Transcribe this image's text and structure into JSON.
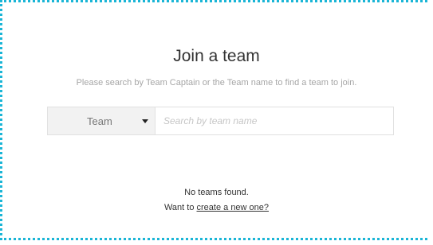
{
  "panel": {
    "title": "Join a team",
    "instructions": "Please search by Team Captain or the Team name to find a team to join."
  },
  "search": {
    "type_selected": "Team",
    "placeholder": "Search by team name",
    "value": ""
  },
  "results": {
    "empty_message": "No teams found.",
    "create_prompt": "Want to ",
    "create_link_text": "create a new one?"
  },
  "colors": {
    "frame_border": "#1ab5d6",
    "select_background": "#f2f2f2"
  },
  "icons": {
    "type_dropdown": "caret-down-icon"
  }
}
